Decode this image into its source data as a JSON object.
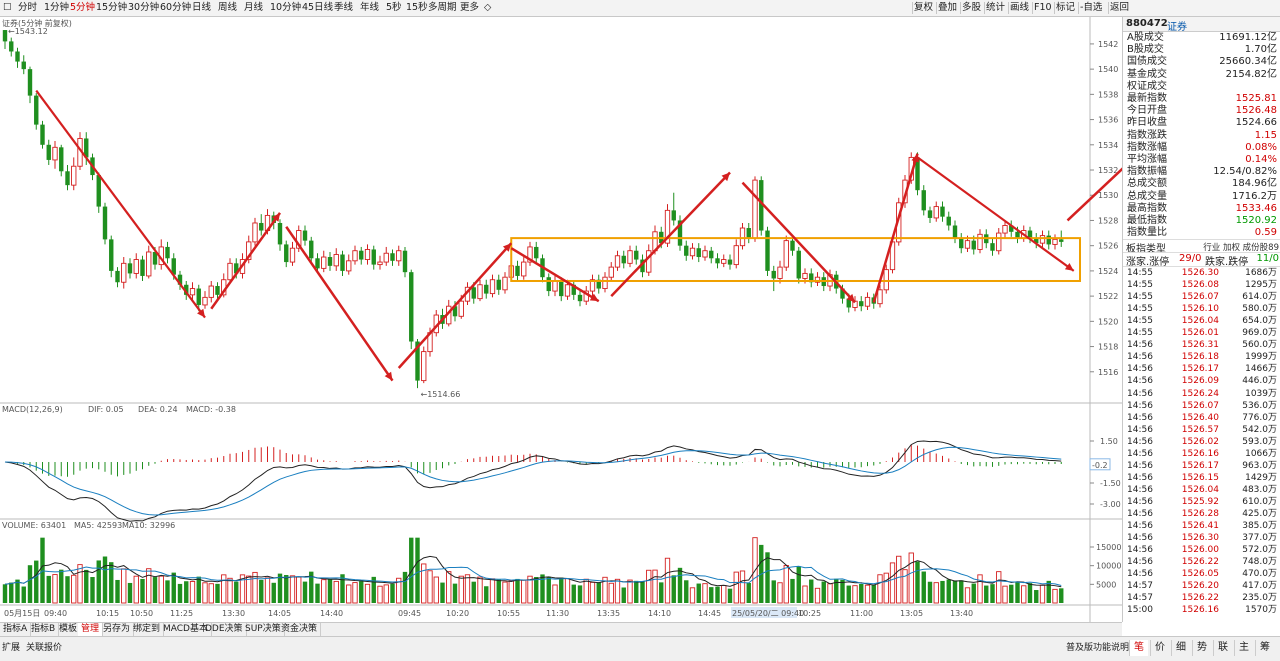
{
  "toolbar": {
    "periods": [
      "分时",
      "1分钟",
      "5分钟",
      "15分钟",
      "30分钟",
      "60分钟",
      "日线",
      "周线",
      "月线",
      "10分钟",
      "45日线",
      "季线",
      "年线",
      "5秒",
      "15秒",
      "多周期",
      "更多"
    ],
    "active_period": 2,
    "right_buttons": [
      "复权",
      "叠加",
      "多股",
      "统计",
      "画线",
      "F10",
      "标记",
      "-自选",
      "返回"
    ]
  },
  "chart": {
    "title": "证券(5分钟 前复权)",
    "high_label": "1543.12",
    "low_label": "1514.66",
    "price_axis": [
      "1542",
      "1540",
      "1538",
      "1536",
      "1534",
      "1532",
      "1530",
      "1528",
      "1526",
      "1524",
      "1522",
      "1520",
      "1518",
      "1516"
    ],
    "macd_label": "MACD(12,26,9)",
    "macd_dif": "DIF: 0.05",
    "macd_dea": "DEA: 0.24",
    "macd_val": "MACD: -0.38",
    "macd_axis": [
      "1.50",
      "-1.50",
      "-3.00"
    ],
    "macd_current": "-0.2",
    "volume_label": "VOLUME: 63401",
    "volume_ma5": "MA5: 42593",
    "volume_ma10": "MA10: 32996",
    "volume_axis": [
      "15000",
      "10000",
      "5000"
    ],
    "time_labels": [
      "05月15日",
      "09:40",
      "10:15",
      "10:50",
      "11:25",
      "13:30",
      "14:05",
      "14:40",
      "09:45",
      "10:20",
      "10:55",
      "11:30",
      "13:35",
      "14:10",
      "14:45",
      "25/05/20/二 09:40",
      "10:25",
      "11:00",
      "13:05",
      "13:40"
    ]
  },
  "chart_data": {
    "type": "candlestick",
    "candles": [
      [
        1543.1,
        1542.2,
        1543.1,
        1541.6
      ],
      [
        1542.2,
        1541.4,
        1542.5,
        1541.0
      ],
      [
        1541.4,
        1540.6,
        1541.7,
        1540.1
      ],
      [
        1540.6,
        1540.0,
        1541.1,
        1539.6
      ],
      [
        1540.0,
        1537.9,
        1540.2,
        1537.3
      ],
      [
        1537.9,
        1535.6,
        1538.1,
        1535.2
      ],
      [
        1535.6,
        1534.0,
        1535.9,
        1533.7
      ],
      [
        1534.0,
        1532.8,
        1534.4,
        1532.4
      ],
      [
        1532.8,
        1533.8,
        1534.3,
        1532.1
      ],
      [
        1533.8,
        1531.9,
        1534.0,
        1531.5
      ],
      [
        1531.9,
        1530.8,
        1532.4,
        1530.4
      ],
      [
        1530.8,
        1532.3,
        1533.0,
        1530.4
      ],
      [
        1532.3,
        1534.5,
        1535.0,
        1532.0
      ],
      [
        1534.5,
        1533.0,
        1535.0,
        1532.4
      ],
      [
        1533.0,
        1531.6,
        1533.3,
        1531.2
      ],
      [
        1531.6,
        1529.1,
        1531.8,
        1528.6
      ],
      [
        1529.1,
        1526.5,
        1529.4,
        1526.1
      ],
      [
        1526.5,
        1524.0,
        1526.8,
        1523.5
      ],
      [
        1524.0,
        1523.1,
        1524.3,
        1522.7
      ],
      [
        1523.1,
        1524.6,
        1525.1,
        1522.6
      ],
      [
        1524.6,
        1523.8,
        1525.0,
        1523.4
      ],
      [
        1523.8,
        1524.9,
        1525.4,
        1523.4
      ],
      [
        1524.9,
        1523.6,
        1525.2,
        1523.2
      ],
      [
        1523.6,
        1525.5,
        1526.0,
        1523.4
      ],
      [
        1525.5,
        1524.5,
        1525.9,
        1524.1
      ],
      [
        1524.5,
        1525.9,
        1526.5,
        1524.1
      ],
      [
        1525.9,
        1525.0,
        1526.3,
        1524.6
      ],
      [
        1525.0,
        1523.7,
        1525.4,
        1523.3
      ],
      [
        1523.7,
        1522.9,
        1524.0,
        1522.5
      ],
      [
        1522.9,
        1522.1,
        1523.2,
        1521.7
      ],
      [
        1522.1,
        1522.6,
        1523.1,
        1521.6
      ],
      [
        1522.6,
        1521.3,
        1522.9,
        1520.8
      ],
      [
        1521.3,
        1521.9,
        1522.4,
        1521.0
      ],
      [
        1521.9,
        1522.8,
        1523.2,
        1521.5
      ],
      [
        1522.8,
        1522.1,
        1523.1,
        1521.7
      ],
      [
        1522.1,
        1523.3,
        1523.8,
        1521.9
      ],
      [
        1523.3,
        1524.6,
        1525.0,
        1523.0
      ],
      [
        1524.6,
        1523.8,
        1525.0,
        1523.4
      ],
      [
        1523.8,
        1524.9,
        1525.4,
        1523.4
      ],
      [
        1524.9,
        1526.3,
        1526.8,
        1524.6
      ],
      [
        1526.3,
        1527.8,
        1528.2,
        1526.0
      ],
      [
        1527.8,
        1527.2,
        1528.5,
        1526.8
      ],
      [
        1527.2,
        1528.4,
        1528.9,
        1526.9
      ],
      [
        1528.4,
        1527.8,
        1528.7,
        1527.3
      ],
      [
        1527.8,
        1526.1,
        1528.1,
        1525.6
      ],
      [
        1526.1,
        1524.7,
        1526.4,
        1524.3
      ],
      [
        1524.7,
        1525.8,
        1526.3,
        1524.4
      ],
      [
        1525.8,
        1527.2,
        1527.6,
        1525.5
      ],
      [
        1527.2,
        1526.4,
        1527.6,
        1526.0
      ],
      [
        1526.4,
        1525.0,
        1526.7,
        1524.6
      ],
      [
        1525.0,
        1524.2,
        1525.4,
        1523.8
      ],
      [
        1524.2,
        1525.1,
        1525.6,
        1523.9
      ],
      [
        1525.1,
        1524.4,
        1525.5,
        1524.0
      ],
      [
        1524.4,
        1525.3,
        1525.8,
        1524.0
      ],
      [
        1525.3,
        1524.0,
        1525.6,
        1523.6
      ],
      [
        1524.0,
        1524.8,
        1525.3,
        1523.7
      ],
      [
        1524.8,
        1525.6,
        1526.0,
        1524.5
      ],
      [
        1525.6,
        1524.9,
        1525.9,
        1524.5
      ],
      [
        1524.9,
        1525.7,
        1526.1,
        1524.5
      ],
      [
        1525.7,
        1524.5,
        1526.0,
        1524.1
      ],
      [
        1524.5,
        1524.7,
        1525.2,
        1524.1
      ],
      [
        1524.7,
        1525.4,
        1525.9,
        1524.4
      ],
      [
        1525.4,
        1524.8,
        1525.7,
        1524.4
      ],
      [
        1524.8,
        1525.6,
        1526.0,
        1524.4
      ],
      [
        1525.6,
        1523.9,
        1525.9,
        1523.5
      ],
      [
        1523.9,
        1518.4,
        1524.1,
        1517.8
      ],
      [
        1518.4,
        1515.3,
        1518.6,
        1514.7
      ],
      [
        1515.3,
        1517.6,
        1518.0,
        1515.1
      ],
      [
        1517.6,
        1519.1,
        1519.5,
        1517.2
      ],
      [
        1519.1,
        1520.5,
        1520.9,
        1518.8
      ],
      [
        1520.5,
        1519.8,
        1521.0,
        1519.4
      ],
      [
        1519.8,
        1521.2,
        1521.7,
        1519.6
      ],
      [
        1521.2,
        1520.4,
        1521.6,
        1520.0
      ],
      [
        1520.4,
        1521.6,
        1522.1,
        1520.2
      ],
      [
        1521.6,
        1522.7,
        1523.1,
        1521.3
      ],
      [
        1522.7,
        1521.8,
        1523.1,
        1521.4
      ],
      [
        1521.8,
        1522.9,
        1523.3,
        1521.6
      ],
      [
        1522.9,
        1522.2,
        1523.3,
        1521.8
      ],
      [
        1522.2,
        1523.3,
        1523.7,
        1521.9
      ],
      [
        1523.3,
        1522.5,
        1523.7,
        1522.1
      ],
      [
        1522.5,
        1523.5,
        1523.9,
        1522.2
      ],
      [
        1523.5,
        1524.4,
        1524.8,
        1523.2
      ],
      [
        1524.4,
        1523.6,
        1524.8,
        1523.2
      ],
      [
        1523.6,
        1524.7,
        1525.1,
        1523.3
      ],
      [
        1524.7,
        1525.9,
        1526.3,
        1524.4
      ],
      [
        1525.9,
        1525.0,
        1526.3,
        1524.6
      ],
      [
        1525.0,
        1523.5,
        1525.3,
        1523.1
      ],
      [
        1523.5,
        1522.4,
        1523.8,
        1522.0
      ],
      [
        1522.4,
        1523.2,
        1523.6,
        1522.0
      ],
      [
        1523.2,
        1522.0,
        1523.5,
        1521.6
      ],
      [
        1522.0,
        1522.9,
        1523.3,
        1521.7
      ],
      [
        1522.9,
        1522.1,
        1523.2,
        1521.7
      ],
      [
        1522.1,
        1521.6,
        1522.5,
        1521.2
      ],
      [
        1521.6,
        1522.4,
        1522.8,
        1521.3
      ],
      [
        1522.4,
        1523.3,
        1523.7,
        1522.0
      ],
      [
        1523.3,
        1522.6,
        1523.7,
        1522.2
      ],
      [
        1522.6,
        1523.5,
        1523.9,
        1522.3
      ],
      [
        1523.5,
        1524.3,
        1524.7,
        1523.2
      ],
      [
        1524.3,
        1525.2,
        1525.6,
        1524.0
      ],
      [
        1525.2,
        1524.6,
        1525.6,
        1524.2
      ],
      [
        1524.6,
        1525.6,
        1526.0,
        1524.3
      ],
      [
        1525.6,
        1524.9,
        1526.0,
        1524.5
      ],
      [
        1524.9,
        1523.9,
        1525.3,
        1523.5
      ],
      [
        1523.9,
        1525.6,
        1526.1,
        1523.6
      ],
      [
        1525.6,
        1527.1,
        1527.6,
        1525.3
      ],
      [
        1527.1,
        1526.2,
        1527.5,
        1525.8
      ],
      [
        1526.2,
        1528.8,
        1529.3,
        1525.9
      ],
      [
        1528.8,
        1528.0,
        1530.2,
        1527.6
      ],
      [
        1528.0,
        1526.0,
        1528.4,
        1525.6
      ],
      [
        1526.0,
        1525.2,
        1526.4,
        1524.8
      ],
      [
        1525.2,
        1525.8,
        1526.2,
        1524.9
      ],
      [
        1525.8,
        1525.1,
        1526.2,
        1524.7
      ],
      [
        1525.1,
        1525.6,
        1526.0,
        1524.8
      ],
      [
        1525.6,
        1525.0,
        1525.9,
        1524.6
      ],
      [
        1525.0,
        1524.6,
        1525.4,
        1524.2
      ],
      [
        1524.6,
        1524.9,
        1525.3,
        1524.3
      ],
      [
        1524.9,
        1524.5,
        1525.3,
        1524.1
      ],
      [
        1524.5,
        1526.0,
        1526.5,
        1524.2
      ],
      [
        1526.0,
        1527.4,
        1527.8,
        1525.7
      ],
      [
        1527.4,
        1526.6,
        1527.8,
        1526.2
      ],
      [
        1526.6,
        1531.2,
        1531.5,
        1526.3
      ],
      [
        1531.2,
        1527.2,
        1531.5,
        1526.8
      ],
      [
        1527.2,
        1524.0,
        1527.5,
        1523.6
      ],
      [
        1524.0,
        1523.4,
        1524.4,
        1522.4
      ],
      [
        1523.4,
        1524.3,
        1524.8,
        1523.0
      ],
      [
        1524.3,
        1526.4,
        1526.8,
        1524.0
      ],
      [
        1526.4,
        1525.6,
        1526.8,
        1525.2
      ],
      [
        1525.6,
        1523.4,
        1525.9,
        1523.0
      ],
      [
        1523.4,
        1523.8,
        1524.2,
        1523.0
      ],
      [
        1523.8,
        1523.1,
        1524.2,
        1522.7
      ],
      [
        1523.1,
        1523.5,
        1523.9,
        1522.8
      ],
      [
        1523.5,
        1522.8,
        1523.9,
        1522.4
      ],
      [
        1522.8,
        1523.7,
        1524.1,
        1522.4
      ],
      [
        1523.7,
        1522.6,
        1524.0,
        1522.2
      ],
      [
        1522.6,
        1521.8,
        1522.9,
        1521.4
      ],
      [
        1521.8,
        1521.1,
        1522.2,
        1520.7
      ],
      [
        1521.1,
        1521.6,
        1522.0,
        1520.8
      ],
      [
        1521.6,
        1521.2,
        1522.0,
        1520.8
      ],
      [
        1521.2,
        1521.9,
        1522.3,
        1520.9
      ],
      [
        1521.9,
        1521.4,
        1522.2,
        1521.0
      ],
      [
        1521.4,
        1522.5,
        1522.9,
        1521.1
      ],
      [
        1522.5,
        1524.1,
        1524.5,
        1522.2
      ],
      [
        1524.1,
        1526.3,
        1526.7,
        1523.8
      ],
      [
        1526.3,
        1529.4,
        1529.8,
        1526.0
      ],
      [
        1529.4,
        1531.2,
        1531.6,
        1529.0
      ],
      [
        1531.2,
        1533.0,
        1533.4,
        1530.9
      ],
      [
        1533.0,
        1530.4,
        1533.4,
        1530.0
      ],
      [
        1530.4,
        1528.8,
        1530.8,
        1528.4
      ],
      [
        1528.8,
        1528.2,
        1529.1,
        1527.8
      ],
      [
        1528.2,
        1529.1,
        1529.5,
        1527.9
      ],
      [
        1529.1,
        1528.3,
        1529.5,
        1527.9
      ],
      [
        1528.3,
        1527.6,
        1528.7,
        1527.2
      ],
      [
        1527.6,
        1526.6,
        1528.0,
        1526.2
      ],
      [
        1526.6,
        1525.8,
        1527.0,
        1525.4
      ],
      [
        1525.8,
        1526.4,
        1526.8,
        1525.5
      ],
      [
        1526.4,
        1525.7,
        1526.8,
        1525.3
      ],
      [
        1525.7,
        1526.9,
        1527.3,
        1525.4
      ],
      [
        1526.9,
        1526.2,
        1527.3,
        1525.8
      ],
      [
        1526.2,
        1525.6,
        1526.6,
        1525.2
      ],
      [
        1525.6,
        1527.0,
        1527.4,
        1525.3
      ],
      [
        1527.0,
        1527.6,
        1528.0,
        1526.6
      ],
      [
        1527.6,
        1527.1,
        1528.0,
        1526.7
      ],
      [
        1527.1,
        1526.6,
        1527.5,
        1526.2
      ],
      [
        1526.6,
        1527.2,
        1527.6,
        1526.3
      ],
      [
        1527.2,
        1526.6,
        1527.5,
        1526.2
      ],
      [
        1526.6,
        1526.2,
        1527.0,
        1525.8
      ],
      [
        1526.2,
        1526.8,
        1527.2,
        1525.9
      ],
      [
        1526.8,
        1526.1,
        1527.2,
        1525.7
      ],
      [
        1526.1,
        1526.5,
        1526.9,
        1525.7
      ],
      [
        1526.5,
        1526.3,
        1527.2,
        1525.9
      ]
    ],
    "price_range": [
      1514,
      1543.5
    ]
  },
  "panel": {
    "code": "880472",
    "name": "证券",
    "stats": [
      {
        "k": "A股成交",
        "v": "11691.12亿",
        "c": "#222"
      },
      {
        "k": "B股成交",
        "v": "1.70亿",
        "c": "#222"
      },
      {
        "k": "国债成交",
        "v": "25660.34亿",
        "c": "#222"
      },
      {
        "k": "基金成交",
        "v": "2154.82亿",
        "c": "#222"
      },
      {
        "k": "权证成交",
        "v": "",
        "c": "#222"
      },
      {
        "k": "最新指数",
        "v": "1525.81",
        "c": "#d00000"
      },
      {
        "k": "今日开盘",
        "v": "1526.48",
        "c": "#d00000"
      },
      {
        "k": "昨日收盘",
        "v": "1524.66",
        "c": "#222"
      },
      {
        "k": "指数涨跌",
        "v": "1.15",
        "c": "#d00000"
      },
      {
        "k": "指数涨幅",
        "v": "0.08%",
        "c": "#d00000"
      },
      {
        "k": "平均涨幅",
        "v": "0.14%",
        "c": "#d00000"
      },
      {
        "k": "指数振幅",
        "v": "12.54/0.82%",
        "c": "#222"
      },
      {
        "k": "总成交额",
        "v": "184.96亿",
        "c": "#222"
      },
      {
        "k": "总成交量",
        "v": "1716.2万",
        "c": "#222"
      },
      {
        "k": "最高指数",
        "v": "1533.46",
        "c": "#d00000"
      },
      {
        "k": "最低指数",
        "v": "1520.92",
        "c": "#009900"
      },
      {
        "k": "指数量比",
        "v": "0.59",
        "c": "#d00000"
      }
    ],
    "board_type_label": "板指类型",
    "board_type_value": "行业 加权 成份股89",
    "updown_label": "涨家.涨停",
    "updown_value": "29/0",
    "down_label": "跌家.跌停",
    "down_value": "11/0",
    "ticks": [
      [
        "14:55",
        "1526.30",
        "1686万"
      ],
      [
        "14:55",
        "1526.08",
        "1295万"
      ],
      [
        "14:55",
        "1526.07",
        "614.0万"
      ],
      [
        "14:55",
        "1526.10",
        "580.0万"
      ],
      [
        "14:55",
        "1526.04",
        "654.0万"
      ],
      [
        "14:55",
        "1526.01",
        "969.0万"
      ],
      [
        "14:56",
        "1526.31",
        "560.0万"
      ],
      [
        "14:56",
        "1526.18",
        "1999万"
      ],
      [
        "14:56",
        "1526.17",
        "1466万"
      ],
      [
        "14:56",
        "1526.09",
        "446.0万"
      ],
      [
        "14:56",
        "1526.24",
        "1039万"
      ],
      [
        "14:56",
        "1526.07",
        "536.0万"
      ],
      [
        "14:56",
        "1526.40",
        "776.0万"
      ],
      [
        "14:56",
        "1526.57",
        "542.0万"
      ],
      [
        "14:56",
        "1526.02",
        "593.0万"
      ],
      [
        "14:56",
        "1526.16",
        "1066万"
      ],
      [
        "14:56",
        "1526.17",
        "963.0万"
      ],
      [
        "14:56",
        "1526.15",
        "1429万"
      ],
      [
        "14:56",
        "1526.04",
        "483.0万"
      ],
      [
        "14:56",
        "1525.92",
        "610.0万"
      ],
      [
        "14:56",
        "1526.28",
        "425.0万"
      ],
      [
        "14:56",
        "1526.41",
        "385.0万"
      ],
      [
        "14:56",
        "1526.30",
        "377.0万"
      ],
      [
        "14:56",
        "1526.00",
        "572.0万"
      ],
      [
        "14:56",
        "1526.22",
        "748.0万"
      ],
      [
        "14:56",
        "1526.05",
        "470.0万"
      ],
      [
        "14:57",
        "1526.20",
        "417.0万"
      ],
      [
        "14:57",
        "1526.22",
        "235.0万"
      ],
      [
        "15:00",
        "1526.16",
        "1570万"
      ]
    ]
  },
  "tabs1": [
    "指标A",
    "指标B",
    "模板",
    "管理",
    "另存为",
    "绑定到",
    "MACD基本",
    "DDE决策",
    "SUP决策",
    "资金决策"
  ],
  "tabs1_active": 3,
  "tabs2": [
    "扩展",
    "关联报价"
  ],
  "help_text": "普及版功能说明",
  "bottom_buttons": [
    "笔",
    "价",
    "细",
    "势",
    "联",
    "主",
    "筹"
  ],
  "bottom_active": 0
}
